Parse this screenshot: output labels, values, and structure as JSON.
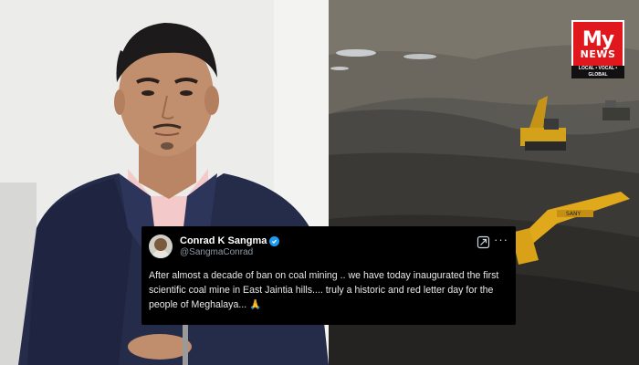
{
  "tweet": {
    "display_name": "Conrad K Sangma",
    "handle": "@SangmaConrad",
    "text": "After  almost a decade of ban on coal mining .. we have today inaugurated the first scientific coal mine in East Jaintia hills.... truly a historic and red letter day for the people of Meghalaya... 🙏",
    "verified_color": "#1d9bf0",
    "icons": [
      "verified-badge-icon",
      "grok-icon",
      "more-options-icon"
    ]
  },
  "logo": {
    "line1": "My",
    "line2": "NEWS",
    "tagline": "LOCAL • VOCAL • GLOBAL",
    "color": "#e0171d"
  },
  "images": {
    "left": "portrait-of-man-in-suit",
    "right": "coal-mine-with-excavators"
  }
}
